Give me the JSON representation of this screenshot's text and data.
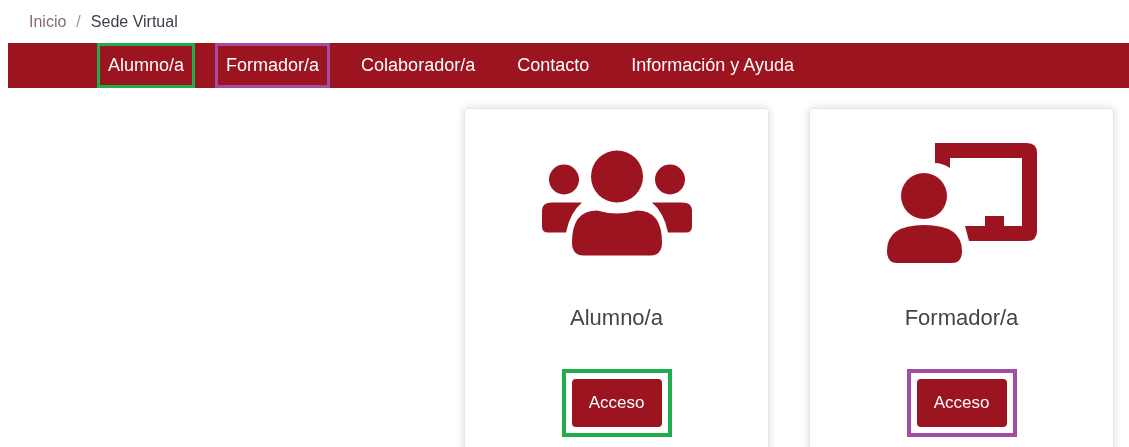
{
  "breadcrumb_separator": "/",
  "breadcrumb": [
    {
      "label": "Inicio",
      "current": false
    },
    {
      "label": "Sede Virtual",
      "current": true
    }
  ],
  "nav": [
    {
      "label": "Alumno/a",
      "color": "#1fae4b"
    },
    {
      "label": "Formador/a",
      "color": "#a24ca6"
    },
    {
      "label": "Colaborador/a"
    },
    {
      "label": "Contacto"
    },
    {
      "label": "Información y Ayuda"
    }
  ],
  "cards": [
    {
      "kind": "group",
      "title": "Alumno/a",
      "button": "Acceso",
      "color": "#1fae4b"
    },
    {
      "kind": "teacher",
      "title": "Formador/a",
      "button": "Acceso",
      "color": "#a24ca6"
    }
  ]
}
